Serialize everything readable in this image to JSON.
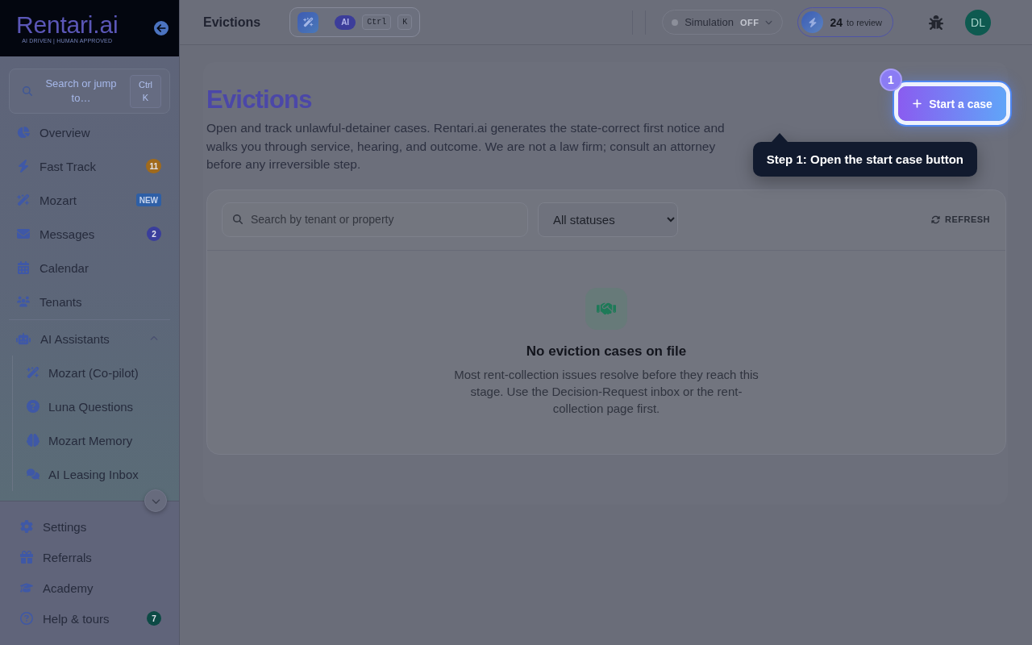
{
  "sidebar": {
    "logo": {
      "name": "Rentari.ai",
      "tagline": "AI DRIVEN | HUMAN APPROVED"
    },
    "search": {
      "label": "Search or jump to…",
      "shortcut": "Ctrl K"
    },
    "nav": [
      {
        "label": "Overview",
        "selected": false
      },
      {
        "label": "Fast Track",
        "selected": false,
        "badge": {
          "text": "11",
          "kind": "count",
          "color": "#a06a1c"
        }
      },
      {
        "label": "Mozart",
        "selected": false,
        "badge": {
          "text": "NEW",
          "kind": "tag",
          "color": "#2e5fa6"
        }
      },
      {
        "label": "Messages",
        "selected": false,
        "badge": {
          "text": "2",
          "kind": "count",
          "color": "#3a3e9c"
        }
      },
      {
        "label": "Calendar",
        "selected": false
      },
      {
        "label": "Tenants",
        "selected": false
      }
    ],
    "group": {
      "label": "AI Assistants",
      "expanded": true,
      "children": [
        {
          "label": "Mozart (Co-pilot)",
          "selected": false
        },
        {
          "label": "Luna Questions",
          "selected": false
        },
        {
          "label": "Mozart Memory",
          "selected": false
        },
        {
          "label": "AI Leasing Inbox",
          "selected": false
        }
      ]
    },
    "footer_nav": [
      {
        "label": "Settings",
        "selected": false
      },
      {
        "label": "Referrals",
        "selected": false
      },
      {
        "label": "Academy",
        "selected": false
      },
      {
        "label": "Help & tours",
        "selected": false,
        "badge": {
          "text": "7",
          "kind": "count",
          "color": "#0d4a45"
        }
      }
    ]
  },
  "header": {
    "title": "Evictions",
    "ai_bar": {
      "badge": "AI",
      "keys": [
        "Ctrl",
        "K"
      ]
    },
    "simulation": {
      "label": "Simulation",
      "state": "OFF",
      "on": false
    },
    "review": {
      "count": "24",
      "label": "to review"
    },
    "avatar": {
      "initials": "DL"
    }
  },
  "page": {
    "title": "Evictions",
    "description": "Open and track unlawful-detainer cases. Rentari.ai generates the state-correct first notice and walks you through service, hearing, and outcome. We are not a law firm; consult an attorney before any irreversible step.",
    "primary_button": {
      "label": "Start a case"
    }
  },
  "filters": {
    "search": {
      "placeholder": "Search by tenant or property"
    },
    "status_select": {
      "value": "All statuses"
    },
    "refresh": {
      "label": "REFRESH"
    }
  },
  "empty_state": {
    "title": "No eviction cases on file",
    "text": "Most rent-collection issues resolve before they reach this stage. Use the Decision-Request inbox or the rent-collection page first."
  },
  "tour": {
    "step": "1",
    "tooltip": "Step 1: Open the start case button"
  }
}
